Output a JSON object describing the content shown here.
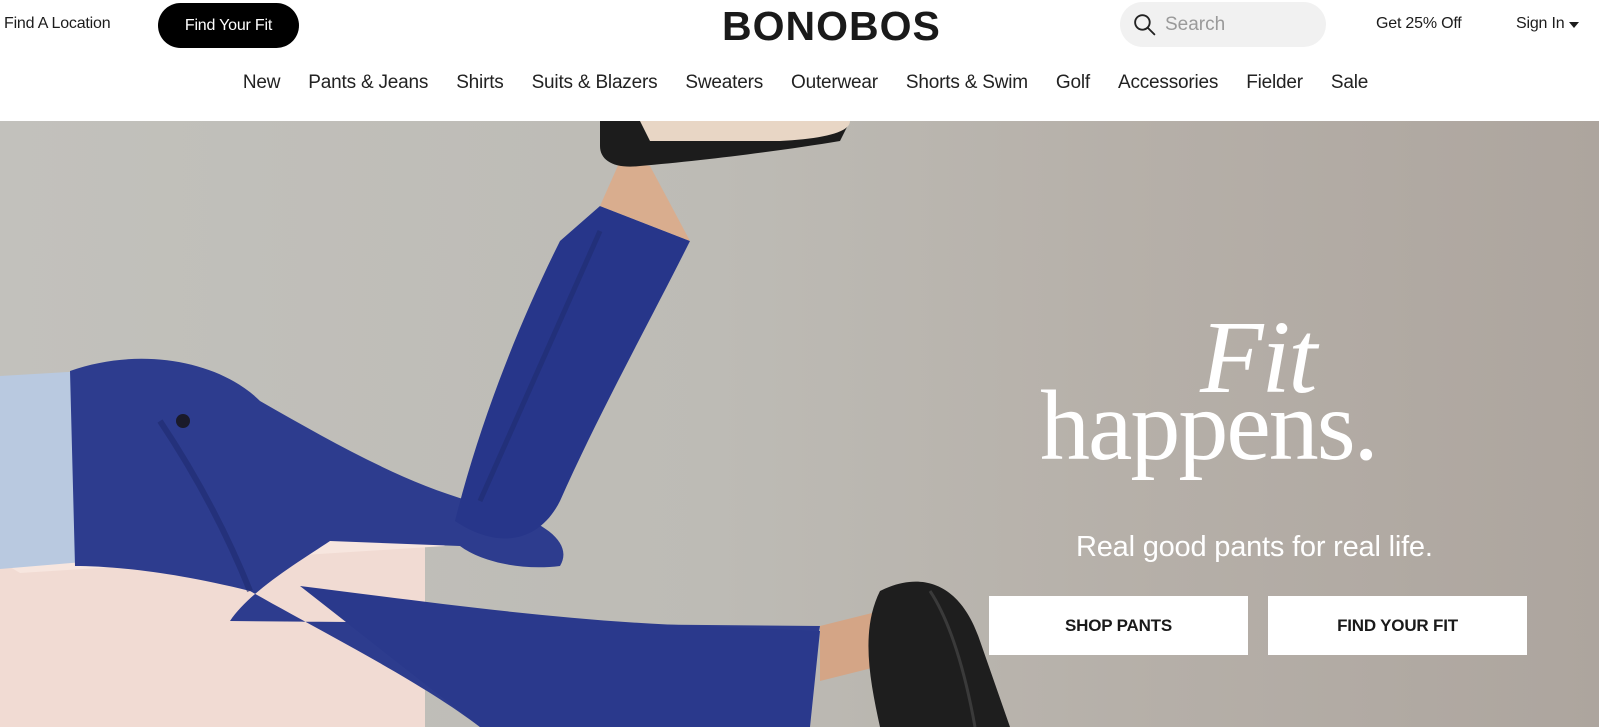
{
  "header": {
    "find_location": "Find A Location",
    "find_fit": "Find Your Fit",
    "logo": "BONOBOS",
    "search_placeholder": "Search",
    "promo": "Get 25% Off",
    "sign_in": "Sign In"
  },
  "nav": {
    "items": [
      "New",
      "Pants & Jeans",
      "Shirts",
      "Suits & Blazers",
      "Sweaters",
      "Outerwear",
      "Shorts & Swim",
      "Golf",
      "Accessories",
      "Fielder",
      "Sale"
    ]
  },
  "hero": {
    "headline_1": "Fit",
    "headline_2": "happens.",
    "tagline": "Real good pants for real life.",
    "cta_primary": "SHOP PANTS",
    "cta_secondary": "FIND YOUR FIT"
  },
  "colors": {
    "pill": "#000000",
    "pants": "#2b3a8c",
    "hero_bg": "#bab7b1"
  },
  "icons": {
    "search": "search-icon",
    "caret": "chevron-down-icon"
  }
}
